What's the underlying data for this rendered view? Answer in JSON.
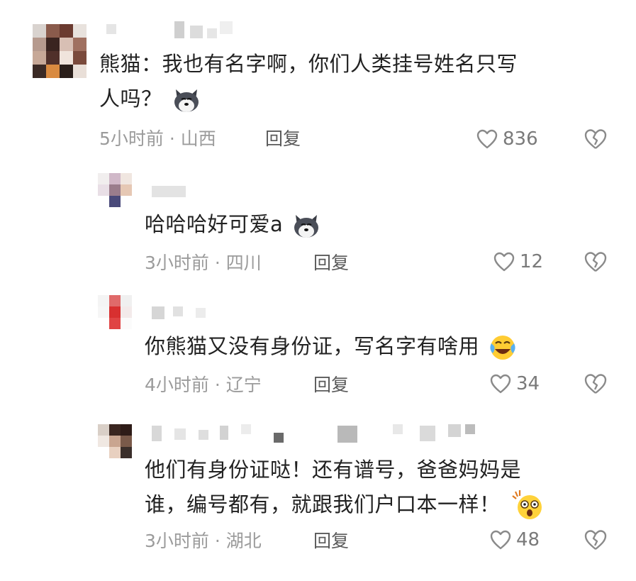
{
  "comments": [
    {
      "content_line1": "熊猫：我也有名字啊，你们人类挂号姓名只写",
      "content_line2": "人吗？",
      "emoji": "husky-dog-emoji",
      "meta": "5小时前 · 山西",
      "reply_label": "回复",
      "likes": "836"
    },
    {
      "content_line1": "哈哈哈好可爱a",
      "emoji": "husky-dog-emoji",
      "meta": "3小时前 · 四川",
      "reply_label": "回复",
      "likes": "12"
    },
    {
      "content_line1": "你熊猫又没有身份证，写名字有啥用",
      "emoji": "laughing-tears-emoji",
      "meta": "4小时前 · 辽宁",
      "reply_label": "回复",
      "likes": "34"
    },
    {
      "content_line1": "他们有身份证哒！还有谱号，爸爸妈妈是",
      "content_line2": "谁，编号都有，就跟我们户口本一样！",
      "emoji": "shocked-face-emoji",
      "meta": "3小时前 · 湖北",
      "reply_label": "回复",
      "likes": "48"
    }
  ],
  "icons": {
    "like": "heart-outline-icon",
    "dislike": "broken-heart-icon"
  },
  "colors": {
    "text": "#222222",
    "meta": "#9b9b9b",
    "reply": "#5a5a5a",
    "icon": "#8a8a8a"
  }
}
